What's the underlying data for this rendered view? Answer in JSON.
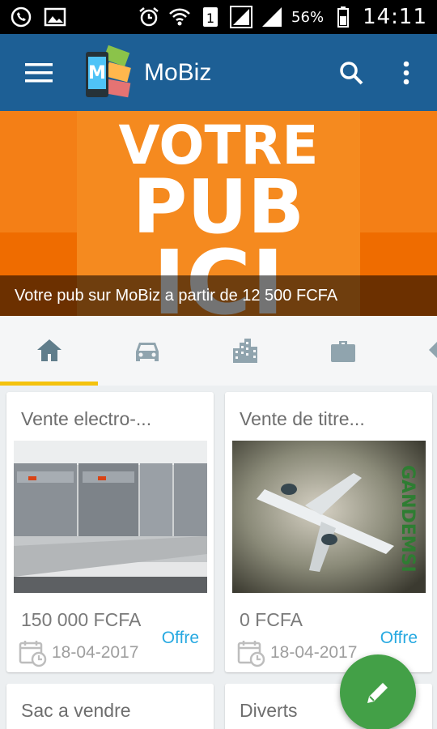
{
  "status_bar": {
    "battery": "56%",
    "time": "14:11",
    "sim_slot": "1",
    "icons": [
      "whatsapp-icon",
      "image-icon",
      "alarm-icon",
      "wifi-icon",
      "sim-icon",
      "signal-icon",
      "signal-icon",
      "battery-icon"
    ]
  },
  "app_bar": {
    "title": "MoBiz",
    "icons": [
      "menu-icon",
      "search-icon",
      "more-vert-icon"
    ],
    "color": "#1d5f95"
  },
  "banner": {
    "art_line1": "VOTRE",
    "art_line2": "PUB",
    "art_line3": "ICI",
    "caption": "Votre pub sur MoBiz a partir de 12 500 FCFA",
    "color": "#f47f16"
  },
  "tabs": [
    {
      "icon": "home-icon",
      "active": true
    },
    {
      "icon": "car-icon",
      "active": false
    },
    {
      "icon": "building-icon",
      "active": false
    },
    {
      "icon": "briefcase-icon",
      "active": false
    },
    {
      "icon": "tag-icon",
      "active": false
    }
  ],
  "accent_color": "#f4c20d",
  "listings": [
    {
      "title": "Vente electro-...",
      "price": "150 000 FCFA",
      "type": "Offre",
      "date": "18-04-2017",
      "image": "refrigerators-photo"
    },
    {
      "title": "Vente de titre...",
      "price": "0 FCFA",
      "type": "Offre",
      "date": "18-04-2017",
      "image": "airplane-ticket-photo"
    },
    {
      "title": "Sac a vendre"
    },
    {
      "title": "Diverts"
    }
  ],
  "fab": {
    "icon": "pencil-icon",
    "color": "#43a047"
  }
}
